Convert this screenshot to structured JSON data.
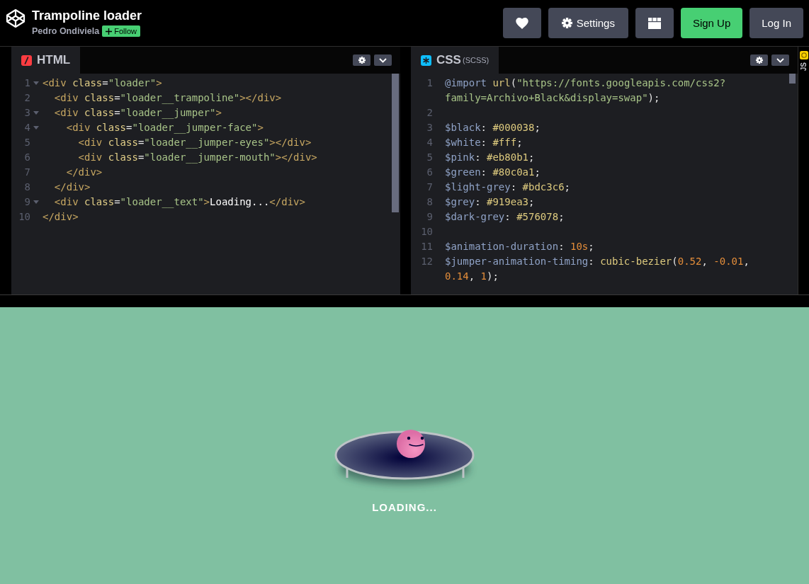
{
  "header": {
    "title": "Trampoline loader",
    "author": "Pedro Ondiviela",
    "follow_button": "Follow",
    "buttons": [
      {
        "kind": "heart"
      },
      {
        "kind": "settings",
        "label": "Settings"
      },
      {
        "kind": "layout"
      },
      {
        "kind": "signup",
        "label": "Sign Up"
      },
      {
        "kind": "login",
        "label": "Log In"
      }
    ]
  },
  "editors": [
    {
      "kind": "html",
      "tab": "HTML",
      "lines": [
        {
          "num": "1",
          "fold": true,
          "tokens": [
            {
              "kind": "tag",
              "text": "<div"
            },
            {
              "kind": "attr",
              "text": " class"
            },
            {
              "kind": "punct",
              "text": "="
            },
            {
              "kind": "string",
              "text": "\"loader\""
            },
            {
              "kind": "tag",
              "text": ">"
            }
          ]
        },
        {
          "num": "2",
          "fold": false,
          "tokens": [
            {
              "kind": "tag",
              "text": "  <div"
            },
            {
              "kind": "attr",
              "text": " class"
            },
            {
              "kind": "punct",
              "text": "="
            },
            {
              "kind": "string",
              "text": "\"loader__trampoline\""
            },
            {
              "kind": "tag",
              "text": "></div>"
            }
          ]
        },
        {
          "num": "3",
          "fold": true,
          "tokens": [
            {
              "kind": "tag",
              "text": "  <div"
            },
            {
              "kind": "attr",
              "text": " class"
            },
            {
              "kind": "punct",
              "text": "="
            },
            {
              "kind": "string",
              "text": "\"loader__jumper\""
            },
            {
              "kind": "tag",
              "text": ">"
            }
          ]
        },
        {
          "num": "4",
          "fold": true,
          "tokens": [
            {
              "kind": "tag",
              "text": "    <div"
            },
            {
              "kind": "attr",
              "text": " class"
            },
            {
              "kind": "punct",
              "text": "="
            },
            {
              "kind": "string",
              "text": "\"loader__jumper-face\""
            },
            {
              "kind": "tag",
              "text": ">"
            }
          ]
        },
        {
          "num": "5",
          "fold": false,
          "tokens": [
            {
              "kind": "tag",
              "text": "      <div"
            },
            {
              "kind": "attr",
              "text": " class"
            },
            {
              "kind": "punct",
              "text": "="
            },
            {
              "kind": "string",
              "text": "\"loader__jumper-eyes\""
            },
            {
              "kind": "tag",
              "text": "></div>"
            }
          ]
        },
        {
          "num": "6",
          "fold": false,
          "tokens": [
            {
              "kind": "tag",
              "text": "      <div"
            },
            {
              "kind": "attr",
              "text": " class"
            },
            {
              "kind": "punct",
              "text": "="
            },
            {
              "kind": "string",
              "text": "\"loader__jumper-mouth\""
            },
            {
              "kind": "tag",
              "text": "></div>"
            }
          ]
        },
        {
          "num": "7",
          "fold": false,
          "tokens": [
            {
              "kind": "tag",
              "text": "    </div>"
            }
          ]
        },
        {
          "num": "8",
          "fold": false,
          "tokens": [
            {
              "kind": "tag",
              "text": "  </div>"
            }
          ]
        },
        {
          "num": "9",
          "fold": true,
          "tokens": [
            {
              "kind": "tag",
              "text": "  <div"
            },
            {
              "kind": "attr",
              "text": " class"
            },
            {
              "kind": "punct",
              "text": "="
            },
            {
              "kind": "string",
              "text": "\"loader__text\""
            },
            {
              "kind": "tag",
              "text": ">"
            },
            {
              "kind": "text",
              "text": "Loading..."
            },
            {
              "kind": "tag",
              "text": "</div>"
            }
          ]
        },
        {
          "num": "10",
          "fold": false,
          "tokens": [
            {
              "kind": "tag",
              "text": "</div>"
            }
          ]
        }
      ]
    },
    {
      "kind": "css",
      "tab": "CSS",
      "tab_note": "(SCSS)",
      "lines": [
        {
          "num": "1",
          "tokens": [
            {
              "kind": "keyword",
              "text": "@import"
            },
            {
              "kind": "func",
              "text": " url"
            },
            {
              "kind": "punct",
              "text": "("
            },
            {
              "kind": "string",
              "text": "\"https://fonts.googleapis.com/css2?"
            }
          ]
        },
        {
          "tokens": [
            {
              "kind": "string",
              "text": "family=Archivo+Black&display=swap\""
            },
            {
              "kind": "punct",
              "text": ");"
            }
          ]
        },
        {
          "num": "2"
        },
        {
          "num": "3",
          "tokens": [
            {
              "kind": "var",
              "text": "$black"
            },
            {
              "kind": "punct",
              "text": ": "
            },
            {
              "kind": "value",
              "text": "#000038"
            },
            {
              "kind": "punct",
              "text": ";"
            }
          ]
        },
        {
          "num": "4",
          "tokens": [
            {
              "kind": "var",
              "text": "$white"
            },
            {
              "kind": "punct",
              "text": ": "
            },
            {
              "kind": "value",
              "text": "#fff"
            },
            {
              "kind": "punct",
              "text": ";"
            }
          ]
        },
        {
          "num": "5",
          "tokens": [
            {
              "kind": "var",
              "text": "$pink"
            },
            {
              "kind": "punct",
              "text": ": "
            },
            {
              "kind": "value",
              "text": "#eb80b1"
            },
            {
              "kind": "punct",
              "text": ";"
            }
          ]
        },
        {
          "num": "6",
          "tokens": [
            {
              "kind": "var",
              "text": "$green"
            },
            {
              "kind": "punct",
              "text": ": "
            },
            {
              "kind": "value",
              "text": "#80c0a1"
            },
            {
              "kind": "punct",
              "text": ";"
            }
          ]
        },
        {
          "num": "7",
          "tokens": [
            {
              "kind": "var",
              "text": "$light-grey"
            },
            {
              "kind": "punct",
              "text": ": "
            },
            {
              "kind": "value",
              "text": "#bdc3c6"
            },
            {
              "kind": "punct",
              "text": ";"
            }
          ]
        },
        {
          "num": "8",
          "tokens": [
            {
              "kind": "var",
              "text": "$grey"
            },
            {
              "kind": "punct",
              "text": ": "
            },
            {
              "kind": "value",
              "text": "#919ea3"
            },
            {
              "kind": "punct",
              "text": ";"
            }
          ]
        },
        {
          "num": "9",
          "tokens": [
            {
              "kind": "var",
              "text": "$dark-grey"
            },
            {
              "kind": "punct",
              "text": ": "
            },
            {
              "kind": "value",
              "text": "#576078"
            },
            {
              "kind": "punct",
              "text": ";"
            }
          ]
        },
        {
          "num": "10"
        },
        {
          "num": "11",
          "tokens": [
            {
              "kind": "var",
              "text": "$animation-duration"
            },
            {
              "kind": "punct",
              "text": ": "
            },
            {
              "kind": "number",
              "text": "10s"
            },
            {
              "kind": "punct",
              "text": ";"
            }
          ]
        },
        {
          "num": "12",
          "tokens": [
            {
              "kind": "var",
              "text": "$jumper-animation-timing"
            },
            {
              "kind": "punct",
              "text": ": "
            },
            {
              "kind": "func",
              "text": "cubic-bezier"
            },
            {
              "kind": "punct",
              "text": "("
            },
            {
              "kind": "number",
              "text": "0.52"
            },
            {
              "kind": "punct",
              "text": ", "
            },
            {
              "kind": "number",
              "text": "-0.01"
            },
            {
              "kind": "punct",
              "text": ","
            }
          ]
        },
        {
          "tokens": [
            {
              "kind": "number",
              "text": "0.14"
            },
            {
              "kind": "punct",
              "text": ", "
            },
            {
              "kind": "number",
              "text": "1"
            },
            {
              "kind": "punct",
              "text": ");"
            }
          ]
        }
      ]
    }
  ],
  "js_panel": {
    "label": "JS"
  },
  "preview": {
    "text": "LOADING..."
  }
}
